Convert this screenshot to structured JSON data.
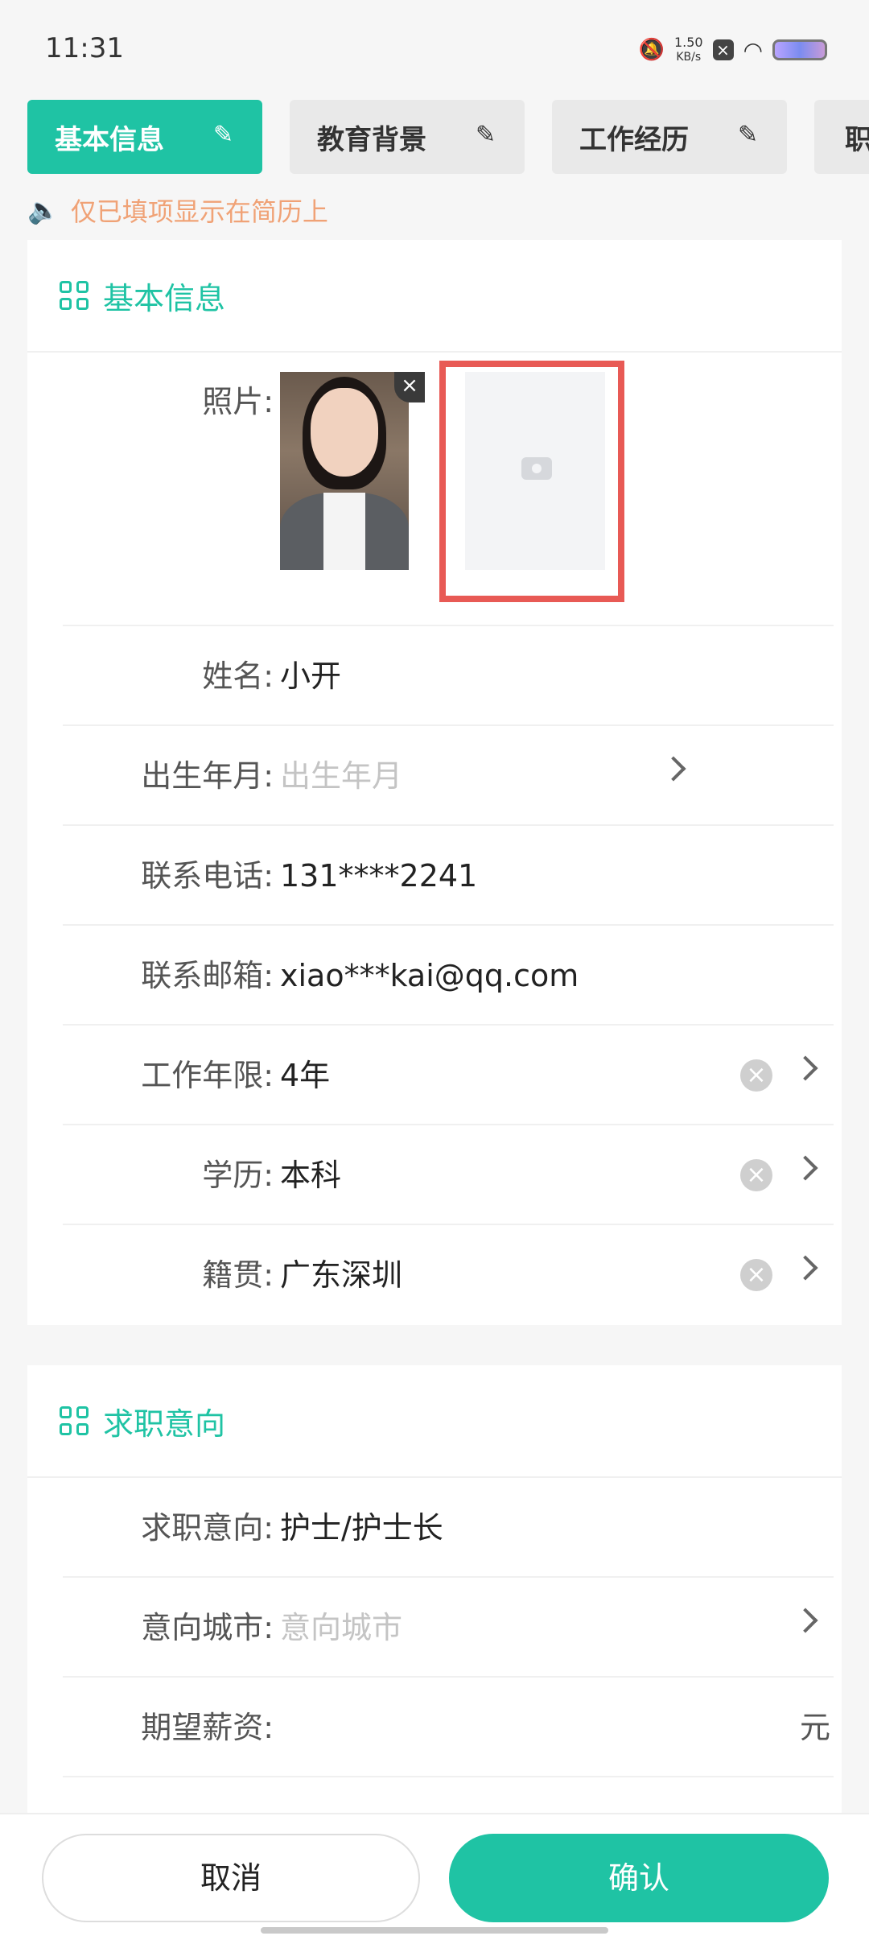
{
  "status": {
    "time": "11:31",
    "speed": "1.50",
    "speed_unit": "KB/s"
  },
  "tabs": [
    {
      "label": "基本信息"
    },
    {
      "label": "教育背景"
    },
    {
      "label": "工作经历"
    },
    {
      "label": "职"
    }
  ],
  "notice": "仅已填项显示在简历上",
  "basic": {
    "title": "基本信息",
    "photo_label": "照片:",
    "rows": [
      {
        "label": "姓名:",
        "value": "小开"
      },
      {
        "label": "出生年月:",
        "placeholder": "出生年月"
      },
      {
        "label": "联系电话:",
        "value": "131****2241"
      },
      {
        "label": "联系邮箱:",
        "value": "xiao***kai@qq.com"
      },
      {
        "label": "工作年限:",
        "value": "4年"
      },
      {
        "label": "学历:",
        "value": "本科"
      },
      {
        "label": "籍贯:",
        "value": "广东深圳"
      }
    ]
  },
  "intent": {
    "title": "求职意向",
    "rows": [
      {
        "label": "求职意向:",
        "value": "护士/护士长"
      },
      {
        "label": "意向城市:",
        "placeholder": "意向城市"
      },
      {
        "label": "期望薪资:",
        "unit": "元"
      }
    ]
  },
  "buttons": {
    "cancel": "取消",
    "confirm": "确认"
  },
  "colors": {
    "accent": "#1fc3a4",
    "notice": "#f0a276",
    "highlight": "#e85a55"
  }
}
